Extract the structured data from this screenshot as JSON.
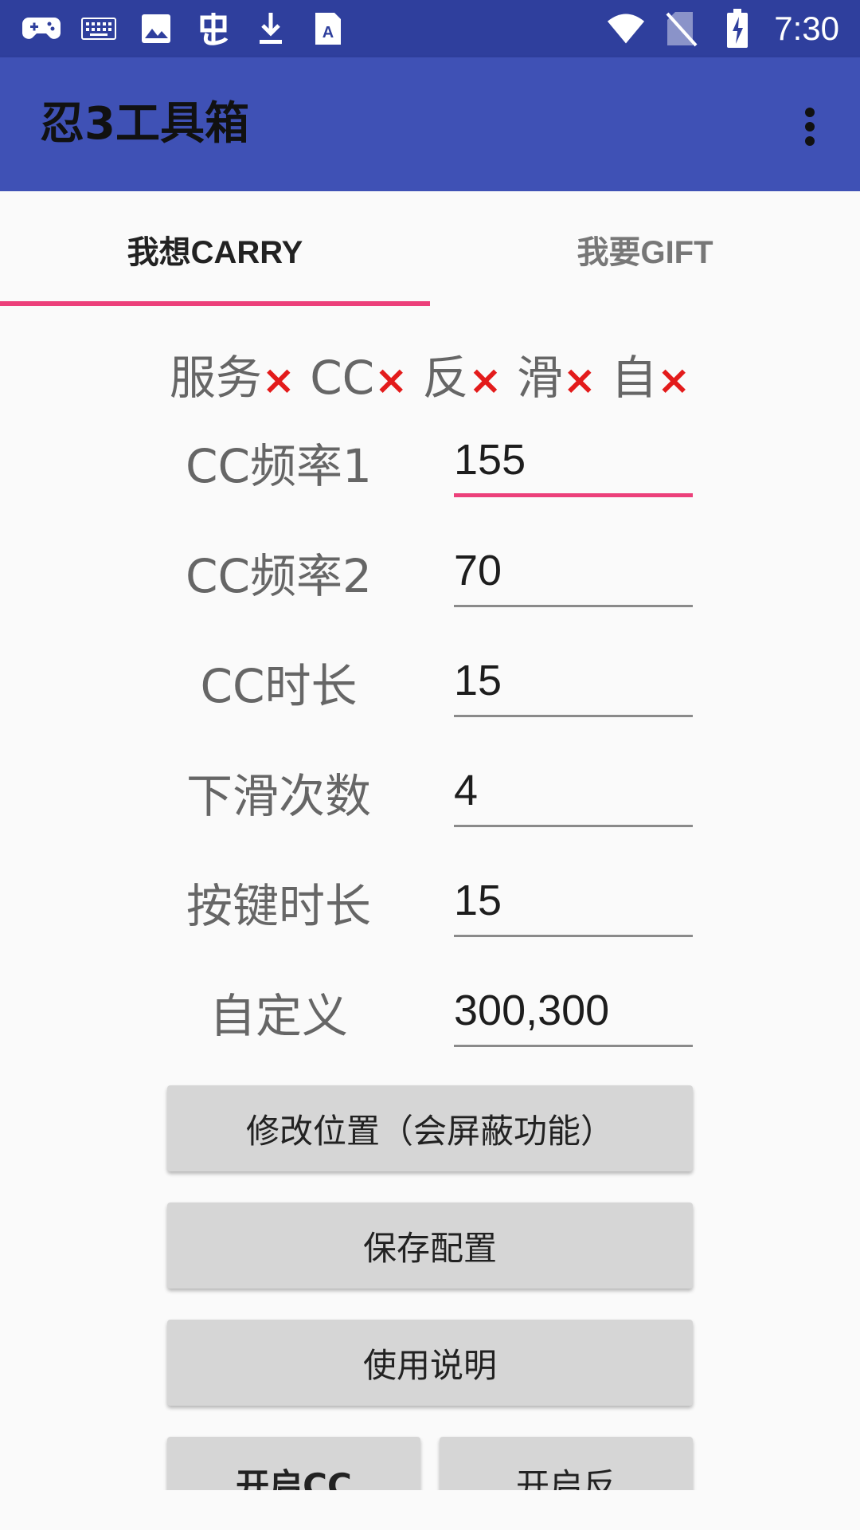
{
  "status_bar": {
    "time": "7:30",
    "left_icons": [
      "gamepad-icon",
      "keyboard-icon",
      "image-icon",
      "app-icon",
      "download-icon",
      "text-icon"
    ],
    "right_icons": [
      "wifi-icon",
      "no-sim-icon",
      "battery-charging-icon"
    ]
  },
  "app_bar": {
    "title": "忍3工具箱"
  },
  "tabs": [
    {
      "label": "我想CARRY",
      "active": true
    },
    {
      "label": "我要GIFT",
      "active": false
    }
  ],
  "status_line": {
    "items": [
      {
        "label": "服务",
        "mark": "×"
      },
      {
        "label": "CC",
        "mark": "×"
      },
      {
        "label": "反",
        "mark": "×"
      },
      {
        "label": "滑",
        "mark": "×"
      },
      {
        "label": "自",
        "mark": "×"
      }
    ]
  },
  "form": {
    "rows": [
      {
        "label": "CC频率1",
        "value": "155"
      },
      {
        "label": "CC频率2",
        "value": "70"
      },
      {
        "label": "CC时长",
        "value": "15"
      },
      {
        "label": "下滑次数",
        "value": "4"
      },
      {
        "label": "按键时长",
        "value": "15"
      },
      {
        "label": "自定义",
        "value": "300,300"
      }
    ]
  },
  "buttons": {
    "modify_position": "修改位置（会屏蔽功能）",
    "save_config": "保存配置",
    "instructions": "使用说明",
    "start_cc": "开启CC",
    "start_fan": "开启反"
  },
  "colors": {
    "status_bar": "#2f3f9d",
    "app_bar": "#3f51b5",
    "accent": "#ec407a",
    "mark_red": "#e31b1b"
  }
}
